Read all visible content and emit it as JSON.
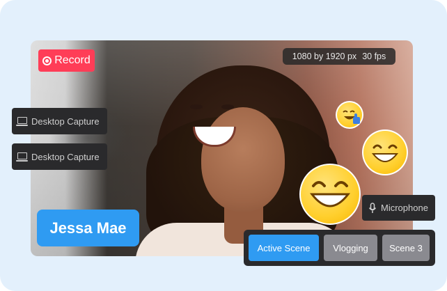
{
  "record": {
    "label": "Record"
  },
  "resolution": {
    "size": "1080 by 1920 px",
    "fps": "30 fps"
  },
  "sources": [
    {
      "label": "Desktop Capture",
      "icon": "laptop-icon"
    },
    {
      "label": "Desktop Capture",
      "icon": "laptop-icon"
    }
  ],
  "name_tag": {
    "name": "Jessa Mae"
  },
  "microphone": {
    "label": "Microphone",
    "icon": "microphone-icon"
  },
  "scenes": [
    {
      "label": "Active Scene",
      "active": true
    },
    {
      "label": "Vlogging",
      "active": false
    },
    {
      "label": "Scene 3",
      "active": false
    }
  ],
  "colors": {
    "record_red": "#ff3d57",
    "accent_blue": "#2f9bf2",
    "chip_dark": "#2a2a2c",
    "scene_gray": "#8a8a90",
    "background": "#e3f0fc"
  },
  "emojis": [
    "thumbs-up-smile-emoji",
    "grin-emoji",
    "laughing-emoji"
  ]
}
